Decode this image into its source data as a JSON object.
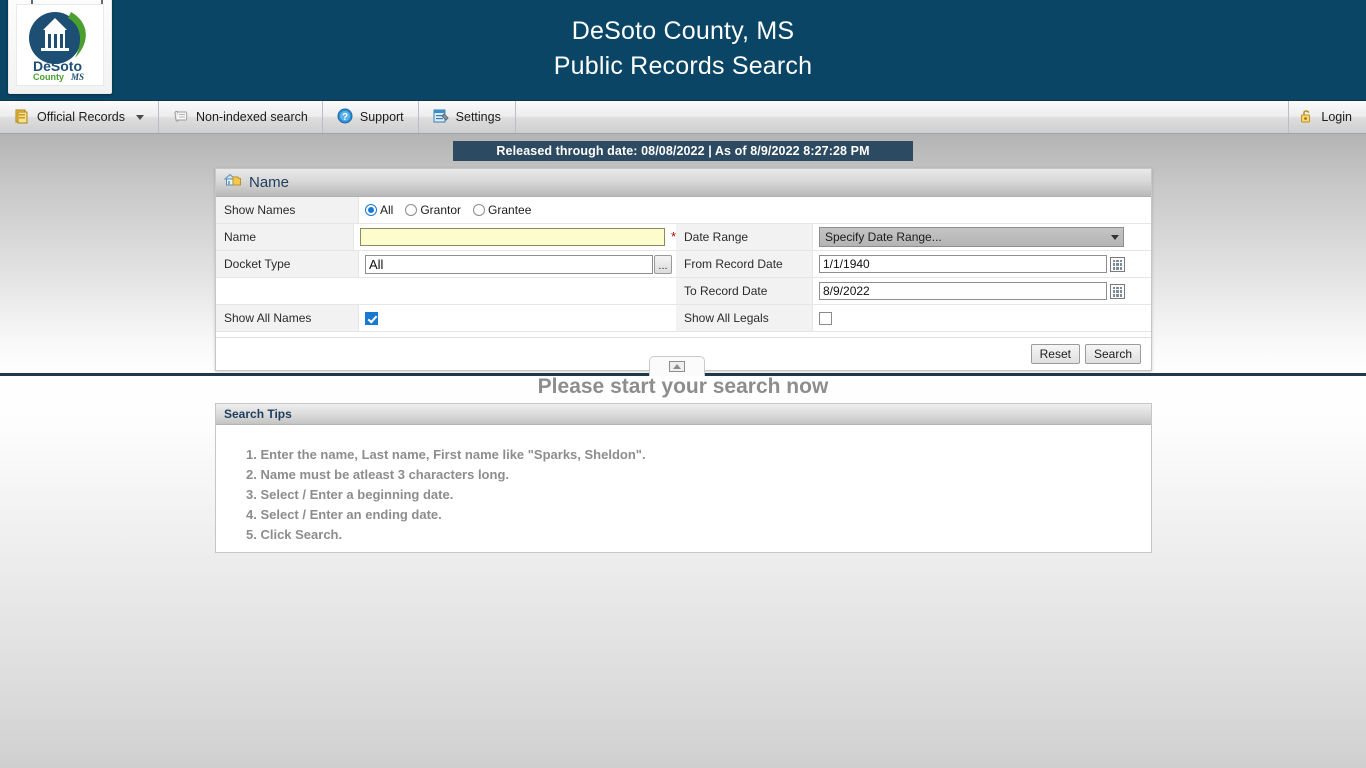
{
  "banner": {
    "title": "DeSoto County, MS\nPublic Records Search",
    "logo_primary": "DeSoto",
    "logo_secondary": "County",
    "logo_state": "MS",
    "bg_color": "#0a4566"
  },
  "toolbar": {
    "items": [
      {
        "label": "Official Records",
        "icon": "book-stack-icon",
        "has_caret": true
      },
      {
        "label": "Non-indexed search",
        "icon": "scroll-icon",
        "has_caret": false
      },
      {
        "label": "Support",
        "icon": "question-circle-icon",
        "has_caret": false
      },
      {
        "label": "Settings",
        "icon": "settings-form-icon",
        "has_caret": false
      }
    ],
    "login_label": "Login",
    "login_icon": "padlock-open-icon"
  },
  "released_banner": {
    "text": "Released through date: 08/08/2022  | As of 8/9/2022 8:27:28 PM",
    "bg_color": "#2d4a63"
  },
  "search_panel": {
    "title": "Name",
    "title_icon": "house-folder-icon",
    "left_rows": {
      "show_names": {
        "label": "Show Names",
        "options": [
          "All",
          "Grantor",
          "Grantee"
        ],
        "selected": "All"
      },
      "name": {
        "label": "Name",
        "value": "",
        "required_marker": "*",
        "highlight_color": "#fdfccd"
      },
      "docket_type": {
        "label": "Docket Type",
        "value": "All",
        "browse_label": "..."
      },
      "show_all_names": {
        "label": "Show All Names",
        "checked": true
      }
    },
    "right_rows": {
      "date_range": {
        "label": "Date Range",
        "value": "Specify Date Range..."
      },
      "from_record_date": {
        "label": "From Record Date",
        "value": "1/1/1940",
        "calendar_icon": "calendar-icon"
      },
      "to_record_date": {
        "label": "To Record Date",
        "value": "8/9/2022",
        "calendar_icon": "calendar-icon"
      },
      "show_all_legals": {
        "label": "Show All Legals",
        "checked": false
      }
    },
    "buttons": {
      "reset": "Reset",
      "search": "Search"
    }
  },
  "collapse_tab": {
    "icon": "collapse-up-icon"
  },
  "start_message": "Please start your search now",
  "tips_panel": {
    "title": "Search Tips",
    "items": [
      "1. Enter the name, Last name, First name like \"Sparks, Sheldon\".",
      "2. Name must be atleast 3 characters long.",
      "3. Select / Enter a beginning date.",
      "4. Select / Enter an ending date.",
      "5. Click Search."
    ]
  }
}
